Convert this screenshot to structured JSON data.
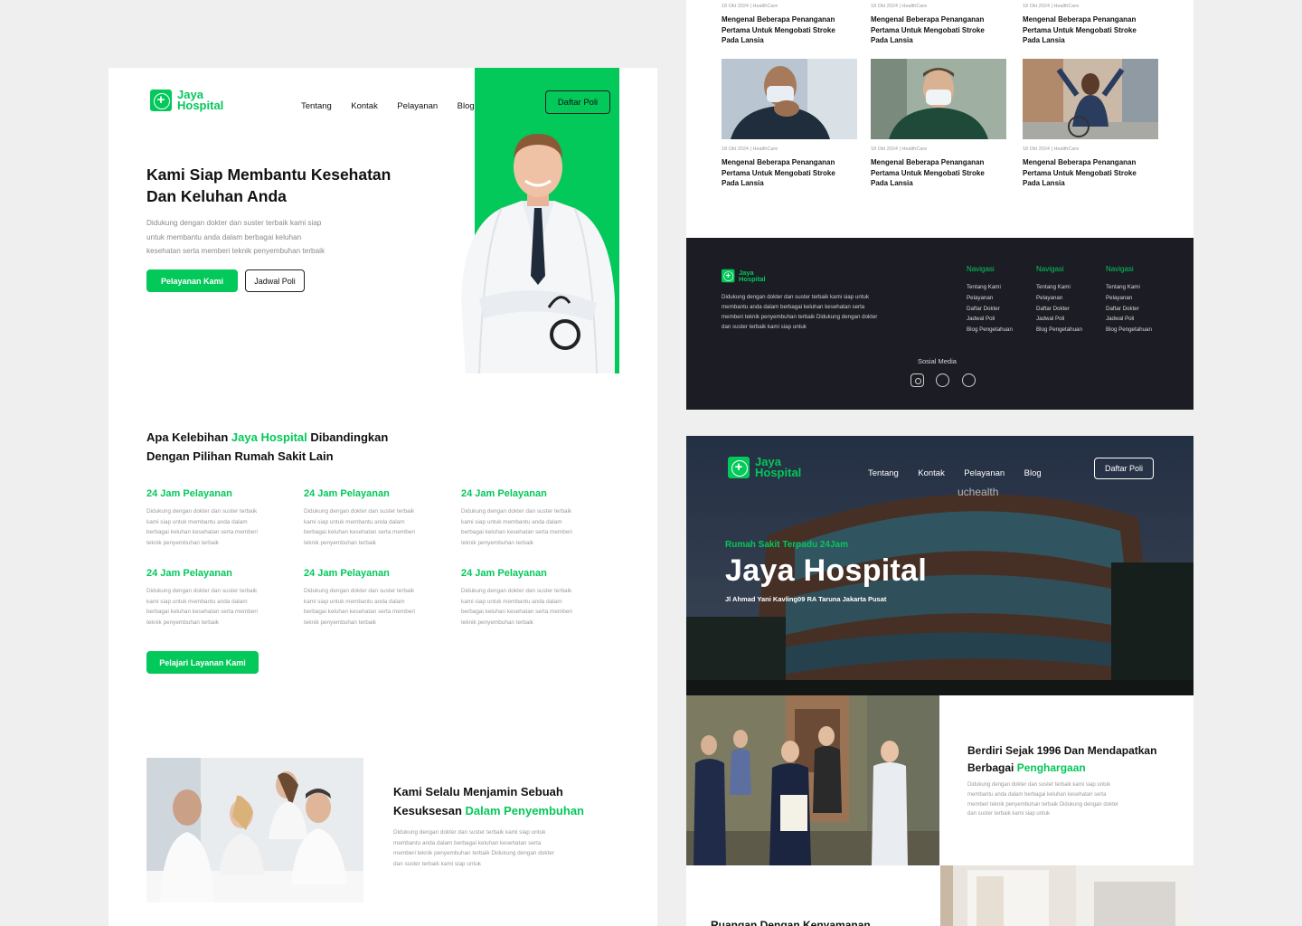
{
  "brand": {
    "line1": "Jaya",
    "line2": "Hospital"
  },
  "nav": [
    "Tentang",
    "Kontak",
    "Pelayanan",
    "Blog"
  ],
  "nav_cta": "Daftar Poli",
  "hero": {
    "title_line1": "Kami Siap Membantu Kesehatan",
    "title_line2": "Dan Keluhan Anda",
    "desc_line1": "Didukung dengan dokter dan suster terbaik kami siap",
    "desc_line2": "untuk membantu anda dalam berbagai keluhan",
    "desc_line3": "kesehatan serta memberi teknik penyembuhan terbaik",
    "primary_btn": "Pelayanan Kami",
    "secondary_btn": "Jadwal Poli"
  },
  "advantages": {
    "title_pre": "Apa Kelebihan ",
    "title_brand": "Jaya Hospital",
    "title_post": " Dibandingkan",
    "title_line2": "Dengan Pilihan Rumah Sakit Lain",
    "items": [
      {
        "title": "24 Jam Pelayanan",
        "l1": "Didukung dengan dokter dan suster terbaik",
        "l2": "kami siap untuk membantu anda dalam",
        "l3": "berbagai keluhan kesehatan serta memberi",
        "l4": "teknik penyembuhan terbaik"
      },
      {
        "title": "24 Jam Pelayanan",
        "l1": "Didukung dengan dokter dan suster terbaik",
        "l2": "kami siap untuk membantu anda dalam",
        "l3": "berbagai keluhan kesehatan serta memberi",
        "l4": "teknik penyembuhan terbaik"
      },
      {
        "title": "24 Jam Pelayanan",
        "l1": "Didukung dengan dokter dan suster terbaik",
        "l2": "kami siap untuk membantu anda dalam",
        "l3": "berbagai keluhan kesehatan serta memberi",
        "l4": "teknik penyembuhan terbaik"
      },
      {
        "title": "24 Jam Pelayanan",
        "l1": "Didukung dengan dokter dan suster terbaik",
        "l2": "kami siap untuk membantu anda dalam",
        "l3": "berbagai keluhan kesehatan serta memberi",
        "l4": "teknik penyembuhan terbaik"
      },
      {
        "title": "24 Jam Pelayanan",
        "l1": "Didukung dengan dokter dan suster terbaik",
        "l2": "kami siap untuk membantu anda dalam",
        "l3": "berbagai keluhan kesehatan serta memberi",
        "l4": "teknik penyembuhan terbaik"
      },
      {
        "title": "24 Jam Pelayanan",
        "l1": "Didukung dengan dokter dan suster terbaik",
        "l2": "kami siap untuk membantu anda dalam",
        "l3": "berbagai keluhan kesehatan serta memberi",
        "l4": "teknik penyembuhan terbaik"
      }
    ],
    "cta": "Pelajari Layanan Kami"
  },
  "guarantee": {
    "title_line1": "Kami Selalu Menjamin Sebuah",
    "title_pre": "Kesuksesan ",
    "title_green": "Dalam Penyembuhan",
    "l1": "Didukung dengan dokter dan suster terbaik kami siap untuk",
    "l2": "membantu anda dalam berbagai keluhan kesehatan serta",
    "l3": "memberi teknik penyembuhan terbaik Didukung dengan dokter",
    "l4": "dan suster terbaik kami siap untuk"
  },
  "blog": {
    "meta_date": "18 Okt 2024",
    "meta_sep": "|",
    "meta_cat": "HealthCare",
    "title_l1": "Mengenal Beberapa Penanganan",
    "title_l2": "Pertama Untuk Mengobati Stroke",
    "title_l3": "Pada Lansia"
  },
  "footer": {
    "l1": "Didukung dengan dokter dan suster terbaik kami siap untuk",
    "l2": "membantu anda dalam berbagai keluhan kesehatan serta",
    "l3": "memberi teknik penyembuhan terbaik Didukung dengan dokter",
    "l4": "dan suster terbaik kami siap untuk",
    "columns": [
      {
        "head": "Navigasi",
        "links": [
          "Tentang Kami",
          "Pelayanan",
          "Daftar Dokter",
          "Jadwal Poli",
          "Blog Pengetahuan"
        ]
      },
      {
        "head": "Navigasi",
        "links": [
          "Tentang Kami",
          "Pelayanan",
          "Daftar Dokter",
          "Jadwal Poli",
          "Blog Pengetahuan"
        ]
      },
      {
        "head": "Navigasi",
        "links": [
          "Tentang Kami",
          "Pelayanan",
          "Daftar Dokter",
          "Jadwal Poli",
          "Blog Pengetahuan"
        ]
      }
    ],
    "social_label": "Sosial Media",
    "social_icons": [
      "instagram-icon",
      "twitter-icon",
      "dribbble-icon"
    ]
  },
  "hero2": {
    "kicker": "Rumah Sakit Terpadu 24Jam",
    "title": "Jaya Hospital",
    "address": "Jl Ahmad Yani Kavling09 RA Taruna Jakarta Pusat",
    "building_sign": "uchealth"
  },
  "about2": {
    "title_line1": "Berdiri Sejak 1996 Dan Mendapatkan",
    "title_pre": "Berbagai ",
    "title_green": "Penghargaan",
    "l1": "Didukung dengan dokter dan suster terbaik kami siap untuk",
    "l2": "membantu anda dalam berbagai keluhan kesehatan serta",
    "l3": "memberi teknik penyembuhan terbaik Didukung dengan dokter",
    "l4": "dan suster terbaik kami siap untuk",
    "next_section_title": "Ruangan Dengan Kenyamanan"
  },
  "colors": {
    "accent": "#03c85a",
    "dark_footer": "#1c1c24"
  }
}
